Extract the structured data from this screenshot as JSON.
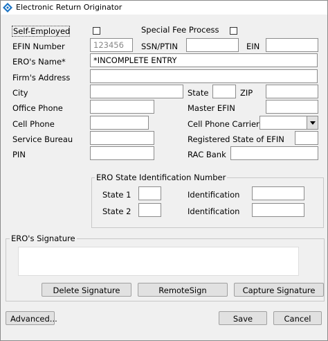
{
  "window": {
    "title": "Electronic Return Originator"
  },
  "fields": {
    "self_employed": {
      "label": "Self-Employed",
      "checked": false
    },
    "special_fee": {
      "label": "Special Fee Process",
      "checked": false
    },
    "efin": {
      "label": "EFIN Number",
      "value": "123456"
    },
    "ssn_ptin": {
      "label": "SSN/PTIN",
      "value": ""
    },
    "ein": {
      "label": "EIN",
      "value": ""
    },
    "ero_name": {
      "label": "ERO's Name*",
      "value": "*INCOMPLETE ENTRY"
    },
    "firm_address": {
      "label": "Firm's Address",
      "value": ""
    },
    "city": {
      "label": "City",
      "value": ""
    },
    "state": {
      "label": "State",
      "value": ""
    },
    "zip": {
      "label": "ZIP",
      "value": ""
    },
    "office_phone": {
      "label": "Office Phone",
      "value": ""
    },
    "master_efin": {
      "label": "Master EFIN",
      "value": ""
    },
    "cell_phone": {
      "label": "Cell Phone",
      "value": ""
    },
    "cell_carrier": {
      "label": "Cell Phone Carrier",
      "value": ""
    },
    "service_bureau": {
      "label": "Service Bureau",
      "value": ""
    },
    "registered_state": {
      "label": "Registered State of EFIN",
      "value": ""
    },
    "pin": {
      "label": "PIN",
      "value": ""
    },
    "rac_bank": {
      "label": "RAC Bank",
      "value": ""
    }
  },
  "state_id": {
    "title": "ERO State Identification Number",
    "state1_label": "State 1",
    "state1_value": "",
    "id1_label": "Identification",
    "id1_value": "",
    "state2_label": "State 2",
    "state2_value": "",
    "id2_label": "Identification",
    "id2_value": ""
  },
  "signature": {
    "title": "ERO's Signature",
    "delete_label": "Delete Signature",
    "remote_label": "RemoteSign",
    "capture_label": "Capture Signature"
  },
  "footer": {
    "advanced_label": "Advanced...",
    "save_label": "Save",
    "cancel_label": "Cancel"
  },
  "icons": {
    "app": "diamond-app-icon",
    "dropdown": "chevron-down-icon"
  },
  "colors": {
    "icon_blue": "#1a73c4",
    "window_bg": "#f0f0f0"
  }
}
